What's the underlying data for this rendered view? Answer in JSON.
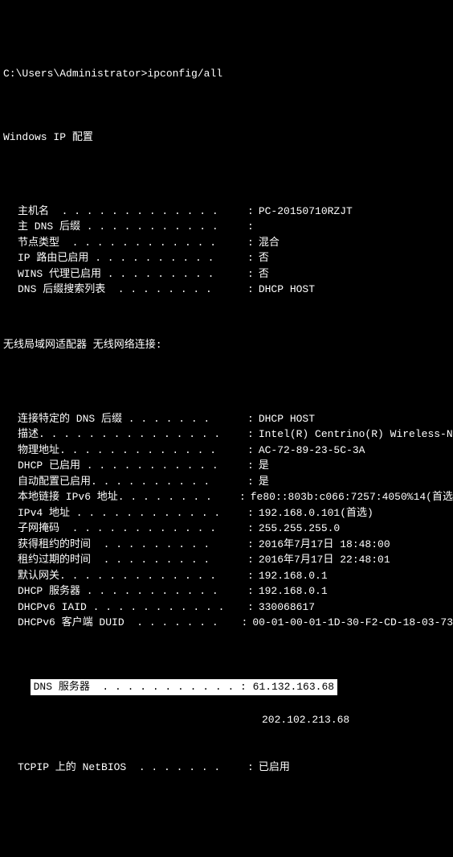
{
  "prompt": "C:\\Users\\Administrator>ipconfig/all",
  "header": "Windows IP 配置",
  "config": [
    {
      "label": "主机名  . . . . . . . . . . . . .",
      "value": "PC-20150710RZJT"
    },
    {
      "label": "主 DNS 后缀 . . . . . . . . . . .",
      "value": ""
    },
    {
      "label": "节点类型  . . . . . . . . . . . .",
      "value": "混合"
    },
    {
      "label": "IP 路由已启用 . . . . . . . . . .",
      "value": "否"
    },
    {
      "label": "WINS 代理已启用 . . . . . . . . .",
      "value": "否"
    },
    {
      "label": "DNS 后缀搜索列表  . . . . . . . .",
      "value": "DHCP HOST"
    }
  ],
  "adapter_header": "无线局域网适配器 无线网络连接:",
  "adapter": [
    {
      "label": "连接特定的 DNS 后缀 . . . . . . .",
      "value": "DHCP HOST"
    },
    {
      "label": "描述. . . . . . . . . . . . . . .",
      "value": "Intel(R) Centrino(R) Wireless-N"
    },
    {
      "label": "物理地址. . . . . . . . . . . . .",
      "value": "AC-72-89-23-5C-3A"
    },
    {
      "label": "DHCP 已启用 . . . . . . . . . . .",
      "value": "是"
    },
    {
      "label": "自动配置已启用. . . . . . . . . .",
      "value": "是"
    },
    {
      "label": "本地链接 IPv6 地址. . . . . . . .",
      "value": "fe80::803b:c066:7257:4050%14(首选"
    },
    {
      "label": "IPv4 地址 . . . . . . . . . . . .",
      "value": "192.168.0.101(首选)"
    },
    {
      "label": "子网掩码  . . . . . . . . . . . .",
      "value": "255.255.255.0"
    },
    {
      "label": "获得租约的时间  . . . . . . . . .",
      "value": "2016年7月17日 18:48:00"
    },
    {
      "label": "租约过期的时间  . . . . . . . . .",
      "value": "2016年7月17日 22:48:01"
    },
    {
      "label": "默认网关. . . . . . . . . . . . .",
      "value": "192.168.0.1"
    },
    {
      "label": "DHCP 服务器 . . . . . . . . . . .",
      "value": "192.168.0.1"
    },
    {
      "label": "DHCPv6 IAID . . . . . . . . . . .",
      "value": "330068617"
    },
    {
      "label": "DHCPv6 客户端 DUID  . . . . . . .",
      "value": "00-01-00-01-1D-30-F2-CD-18-03-73"
    }
  ],
  "dns_highlight": "DNS 服务器  . . . . . . . . . . . : 61.132.163.68",
  "dns_line2": "202.102.213.68",
  "netbios": {
    "label": "TCPIP 上的 NetBIOS  . . . . . . .",
    "value": "已启用"
  }
}
